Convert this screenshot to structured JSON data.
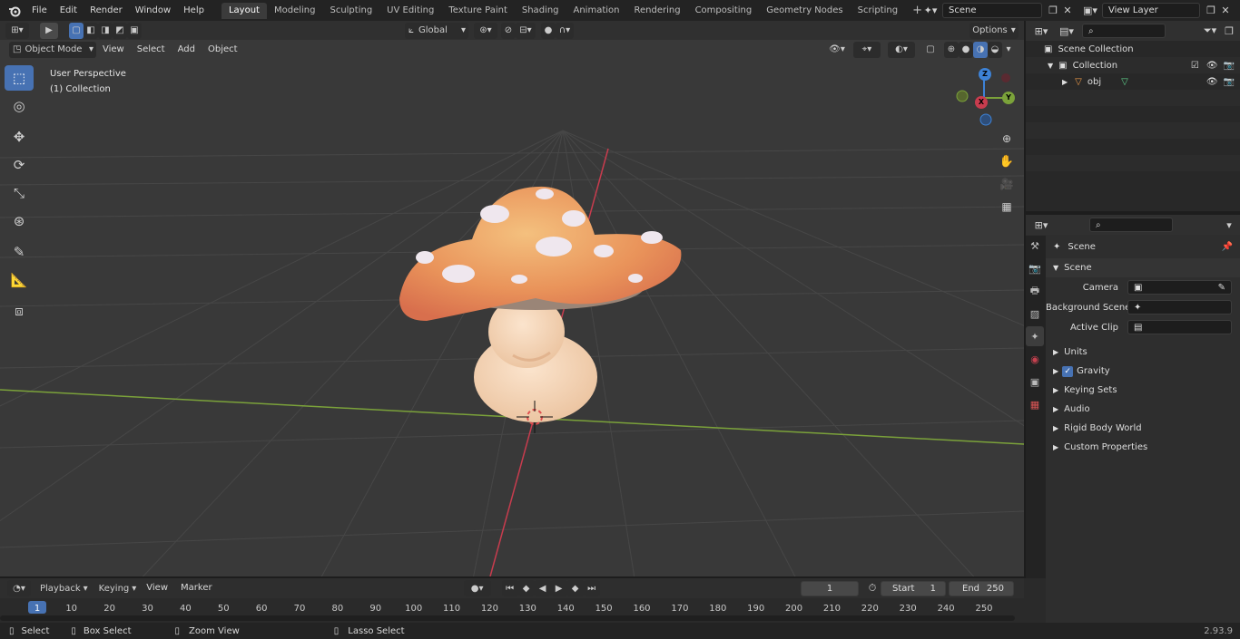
{
  "topbar": {
    "menus": [
      "File",
      "Edit",
      "Render",
      "Window",
      "Help"
    ],
    "workspaces": [
      "Layout",
      "Modeling",
      "Sculpting",
      "UV Editing",
      "Texture Paint",
      "Shading",
      "Animation",
      "Rendering",
      "Compositing",
      "Geometry Nodes",
      "Scripting"
    ],
    "active_workspace": "Layout",
    "add_tab": "+",
    "scene_name": "Scene",
    "view_layer": "View Layer"
  },
  "viewport_header": {
    "mode": "Object Mode",
    "menus": [
      "View",
      "Select",
      "Add",
      "Object"
    ],
    "transform_orientation": "Global",
    "options": "Options"
  },
  "viewport": {
    "perspective_label": "User Perspective",
    "collection_label": "(1) Collection",
    "gizmo_axes": [
      "X",
      "Y",
      "Z"
    ]
  },
  "outliner": {
    "scene_collection": "Scene Collection",
    "collection": "Collection",
    "object": "obj"
  },
  "properties": {
    "context": "Scene",
    "section": "Scene",
    "fields": [
      {
        "label": "Camera",
        "value": ""
      },
      {
        "label": "Background Scene",
        "value": ""
      },
      {
        "label": "Active Clip",
        "value": ""
      }
    ],
    "subpanels": [
      "Units",
      "Gravity",
      "Keying Sets",
      "Audio",
      "Rigid Body World",
      "Custom Properties"
    ],
    "gravity_checked": true
  },
  "timeline": {
    "menus": [
      "Playback",
      "Keying",
      "View",
      "Marker"
    ],
    "current_frame": "1",
    "start_label": "Start",
    "start_value": "1",
    "end_label": "End",
    "end_value": "250",
    "ticks": [
      "1",
      "10",
      "20",
      "30",
      "40",
      "50",
      "60",
      "70",
      "80",
      "90",
      "100",
      "110",
      "120",
      "130",
      "140",
      "150",
      "160",
      "170",
      "180",
      "190",
      "200",
      "210",
      "220",
      "230",
      "240",
      "250"
    ]
  },
  "statusbar": {
    "select": "Select",
    "box_select": "Box Select",
    "zoom_view": "Zoom View",
    "lasso_select": "Lasso Select",
    "version": "2.93.9"
  },
  "colors": {
    "accent": "#4772b3",
    "x_axis": "#c83c4e",
    "y_axis": "#7ba23a",
    "z_axis": "#3d82d6"
  }
}
